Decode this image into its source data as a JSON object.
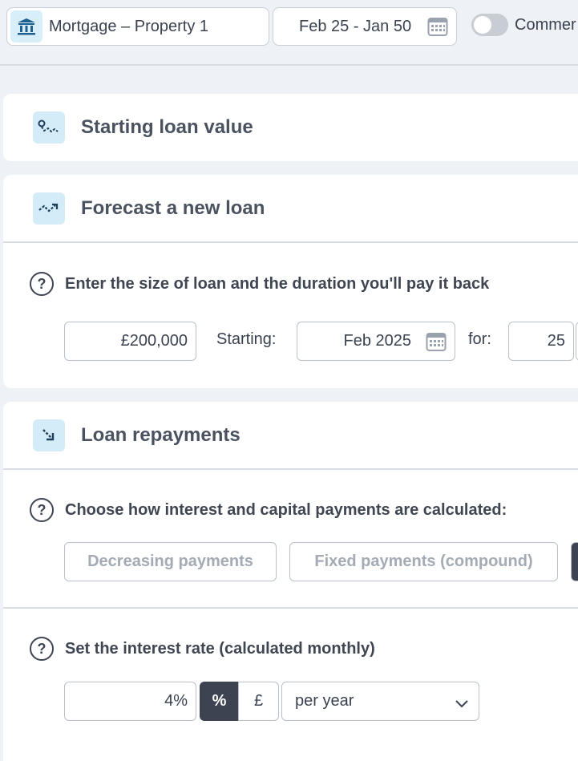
{
  "topbar": {
    "account_name": "Mortgage – Property 1",
    "account_icon": "bank-icon",
    "date_range": "Feb 25 - Jan 50",
    "toggle_label": "Commer",
    "toggle_on": false
  },
  "sections": {
    "starting": {
      "title": "Starting loan value",
      "icon": "chart-path-icon"
    },
    "forecast": {
      "title": "Forecast a new loan",
      "icon": "trend-up-icon",
      "question": "Enter the size of loan and the duration you'll pay it back",
      "loan_amount": "£200,000",
      "starting_label": "Starting:",
      "start_date": "Feb 2025",
      "for_label": "for:",
      "years": "25"
    },
    "repayments": {
      "title": "Loan repayments",
      "icon": "arrow-down-right-icon",
      "question": "Choose how interest and capital payments are calculated:",
      "options": [
        "Decreasing payments",
        "Fixed payments (compound)"
      ],
      "rate_question": "Set the interest rate (calculated monthly)",
      "rate_value": "4%",
      "unit_percent": "%",
      "unit_pound": "£",
      "period": "per year"
    }
  },
  "colors": {
    "icon_bg": "#d4ecf7",
    "dark_button": "#3d4350",
    "page_bg": "#eef1f5"
  }
}
